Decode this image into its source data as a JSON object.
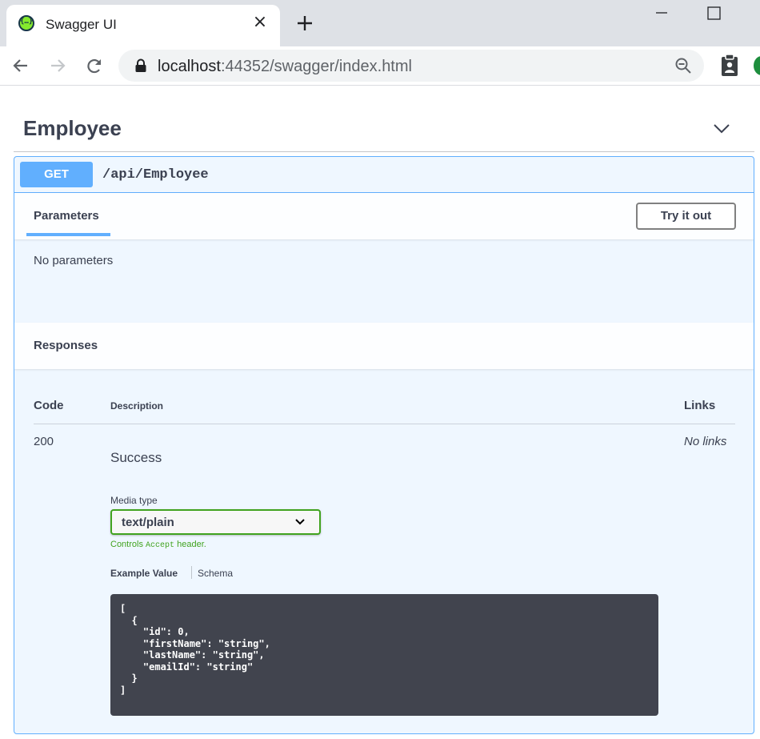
{
  "browser": {
    "tab_title": "Swagger UI",
    "favicon_glyph": "{…}",
    "close_glyph": "×",
    "url_host": "localhost",
    "url_rest": ":44352/swagger/index.html",
    "accent_green": "#1e8e3e"
  },
  "section": {
    "title": "Employee"
  },
  "operation": {
    "method": "GET",
    "path": "/api/Employee",
    "method_color": "#61affe"
  },
  "parameters": {
    "tab_label": "Parameters",
    "try_button": "Try it out",
    "empty_text": "No parameters"
  },
  "responses": {
    "title": "Responses",
    "columns": {
      "code": "Code",
      "description": "Description",
      "links": "Links"
    },
    "rows": [
      {
        "code": "200",
        "description": "Success",
        "links": "No links"
      }
    ],
    "media_type_label": "Media type",
    "media_type_value": "text/plain",
    "controls_prefix": "Controls",
    "controls_code": "Accept",
    "controls_suffix": "header.",
    "example_tab": "Example Value",
    "schema_tab": "Schema",
    "example_value": "[\n  {\n    \"id\": 0,\n    \"firstName\": \"string\",\n    \"lastName\": \"string\",\n    \"emailId\": \"string\"\n  }\n]",
    "valid_color": "#41a31f"
  }
}
